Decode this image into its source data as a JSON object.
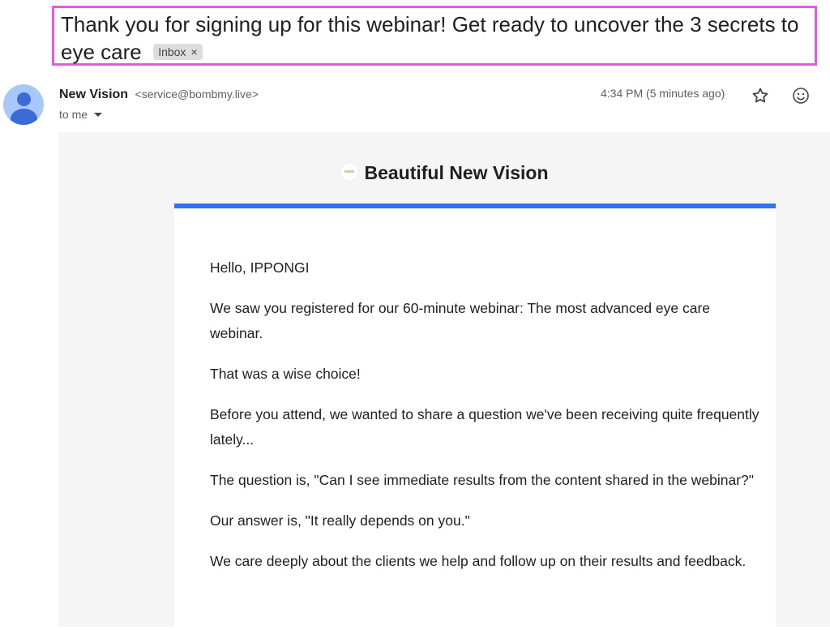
{
  "email": {
    "subject": "Thank you for signing up for this webinar! Get ready to uncover the 3 secrets to eye care",
    "label_chip": "Inbox",
    "label_chip_close": "×",
    "sender_name": "New Vision",
    "sender_email": "<service@bombmy.live>",
    "recipient": "to me",
    "timestamp": "4:34 PM (5 minutes ago)"
  },
  "icons": {
    "avatar": "user-avatar-icon",
    "star": "star-icon",
    "emoji": "emoji-react-icon",
    "caret": "chevron-down-icon"
  },
  "body": {
    "brand_name": "Beautiful New Vision",
    "accent_color": "#2f73f0",
    "paragraphs": [
      "Hello, IPPONGI",
      "We saw you registered for our 60-minute webinar: The most advanced eye care webinar.",
      "That was a wise choice!",
      "Before you attend, we wanted to share a question we've been receiving quite frequently lately...",
      "The question is, \"Can I see immediate results from the content shared in the webinar?\"",
      "Our answer is, \"It really depends on you.\"",
      "We care deeply about the clients we help and follow up on their results and feedback."
    ]
  },
  "highlight_color": "#e35be3"
}
